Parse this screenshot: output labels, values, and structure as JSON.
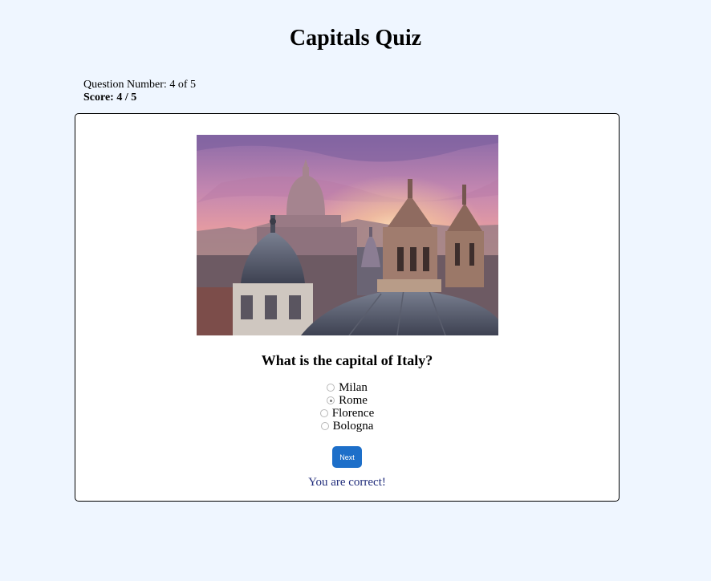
{
  "page": {
    "title": "Capitals Quiz"
  },
  "status": {
    "question_number": "Question Number: 4 of 5",
    "score": "Score: 4 / 5"
  },
  "quiz": {
    "question": "What is the capital of Italy?",
    "image_icon": "rome-skyline-photo",
    "options": [
      {
        "label": "Milan",
        "selected": false
      },
      {
        "label": "Rome",
        "selected": true
      },
      {
        "label": "Florence",
        "selected": false
      },
      {
        "label": "Bologna",
        "selected": false
      }
    ],
    "next_label": "Next",
    "feedback": "You are correct!"
  },
  "colors": {
    "background": "#eff6ff",
    "button": "#1d6fc9",
    "feedback": "#1f2b7a"
  }
}
